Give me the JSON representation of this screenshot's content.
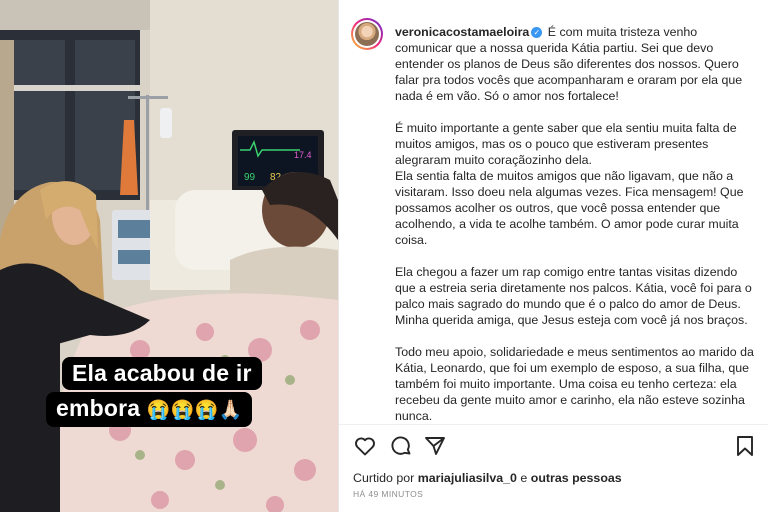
{
  "photo": {
    "caption_line1": "Ela acabou de ir",
    "caption_line2": "embora",
    "caption_emojis": "😭😭😭🙏🏻",
    "monitor_readouts": [
      "99",
      "82",
      "17.4"
    ]
  },
  "post": {
    "username": "veronicacostamaeloira",
    "verified_icon": "verified-badge-icon",
    "paragraphs": [
      "É com muita tristeza venho comunicar que a nossa querida Kátia partiu. Sei que devo entender os planos de Deus são diferentes dos nossos. Quero falar pra todos vocês que acompanharam e oraram por ela que nada é em vão. Só o amor nos fortalece!",
      "É muito importante a gente saber que ela sentiu muita falta de muitos amigos, mas os o pouco que estiveram presentes alegraram muito coraçãozinho dela.\nEla sentia falta de muitos amigos que não ligavam, que não a visitaram. Isso doeu nela algumas vezes. Fica mensagem! Que possamos acolher os outros, que você possa entender que acolhendo, a vida te acolhe também. O amor pode curar muita coisa.",
      "Ela chegou a fazer um rap comigo entre tantas visitas dizendo que a estreia seria diretamente nos palcos. Kátia, você foi para o palco mais sagrado do mundo que é o palco do amor de Deus. Minha querida amiga, que Jesus esteja com você já nos braços.",
      "Todo meu apoio, solidariedade e meus sentimentos ao marido da Kátia, Leonardo, que foi um exemplo de esposo, a sua filha, que também foi muito importante. Uma coisa eu tenho certeza: ela recebeu da gente muito amor e carinho, ela não esteve sozinha nunca."
    ]
  },
  "actions": {
    "icons": [
      "heart-icon",
      "comment-icon",
      "share-icon",
      "bookmark-icon"
    ]
  },
  "likes": {
    "prefix": "Curtido por",
    "user": "mariajuliasilva_0",
    "connector": "e",
    "others": "outras pessoas"
  },
  "timestamp": "HÁ 49 MINUTOS",
  "colors": {
    "verified": "#3897f0",
    "text": "#262626",
    "muted": "#8e8e8e"
  }
}
